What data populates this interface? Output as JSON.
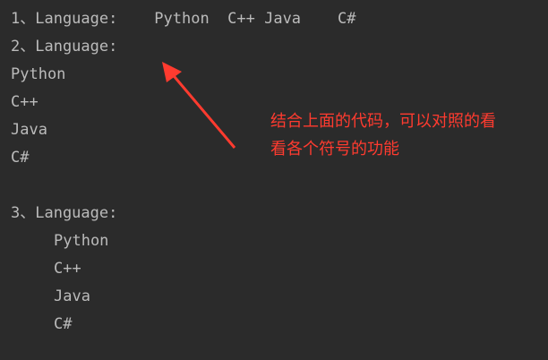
{
  "console": {
    "lines": [
      "1、Language:    Python  C++ Java    C#",
      "2、Language:",
      "Python",
      "C++",
      "Java",
      "C#",
      "",
      "3、Language:",
      "Python",
      "C++",
      "Java",
      "C#"
    ]
  },
  "annotation": {
    "line1": "结合上面的代码，可以对照的看",
    "line2": "看各个符号的功能",
    "color": "#ff3b2f"
  }
}
